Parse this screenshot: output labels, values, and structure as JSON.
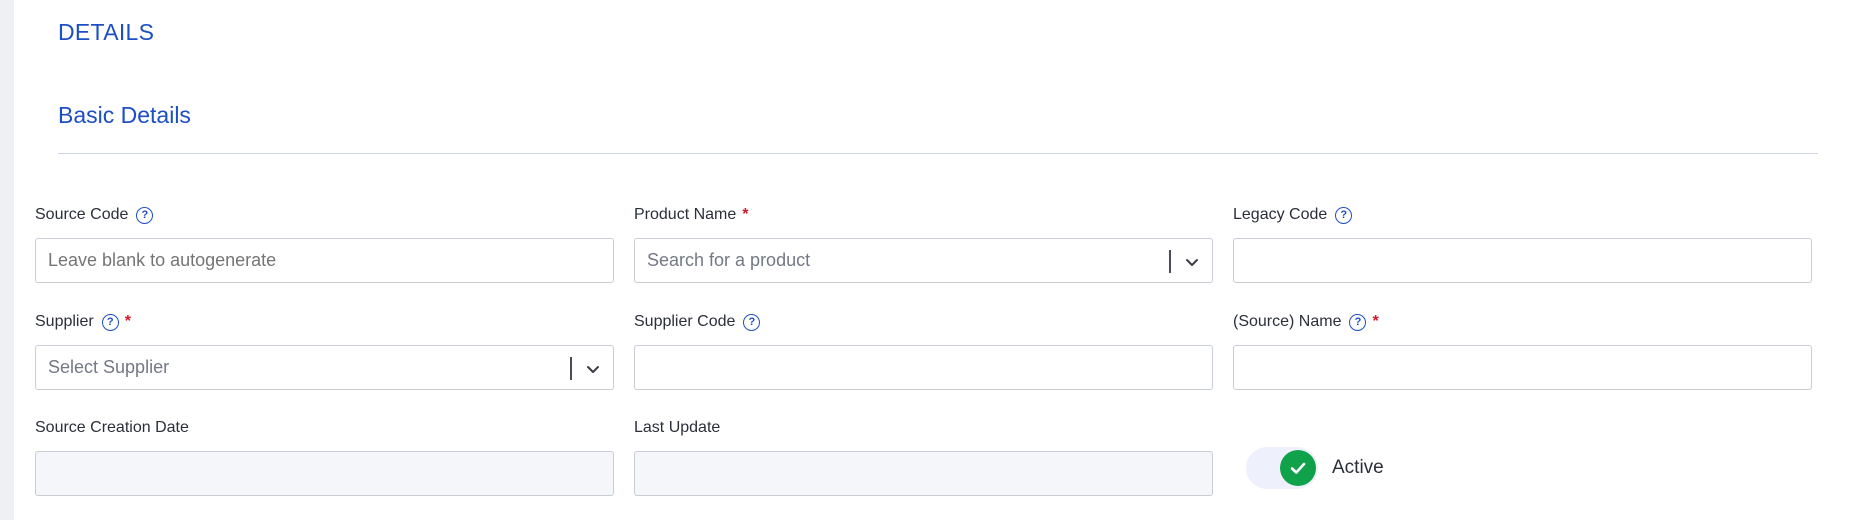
{
  "section": {
    "title": "DETAILS",
    "subtitle": "Basic Details"
  },
  "fields": {
    "source_code": {
      "label": "Source Code",
      "placeholder": "Leave blank to autogenerate",
      "value": ""
    },
    "product_name": {
      "label": "Product Name",
      "required": "*",
      "placeholder": "Search for a product"
    },
    "legacy_code": {
      "label": "Legacy Code",
      "value": ""
    },
    "supplier": {
      "label": "Supplier",
      "required": "*",
      "placeholder": "Select Supplier"
    },
    "supplier_code": {
      "label": "Supplier Code",
      "value": ""
    },
    "source_name": {
      "label": "(Source) Name",
      "required": "*",
      "value": ""
    },
    "source_creation_date": {
      "label": "Source Creation Date",
      "value": ""
    },
    "last_update": {
      "label": "Last Update",
      "value": ""
    }
  },
  "toggle": {
    "label": "Active",
    "state": "on"
  },
  "icons": {
    "help": "question-circle-icon",
    "chevron": "chevron-down-icon",
    "check": "check-icon"
  },
  "colors": {
    "accent": "#1d4fc4",
    "required": "#d11a2a",
    "active": "#10a24a"
  }
}
